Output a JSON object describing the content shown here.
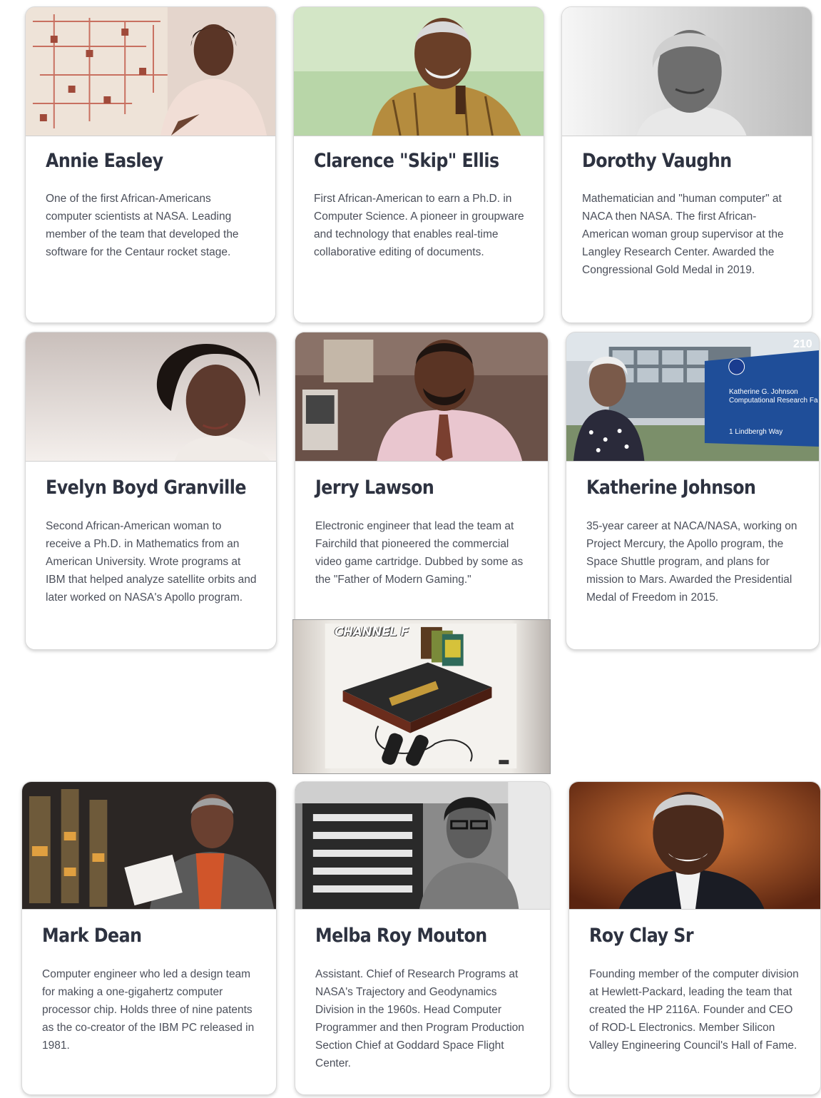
{
  "cards": [
    {
      "name": "Annie Easley",
      "description": "One of the first African-Americans computer scientists at NASA. Leading member of the team that developed the software for the Centaur rocket stage."
    },
    {
      "name": "Clarence \"Skip\" Ellis",
      "description": "First African-American to earn a Ph.D. in Computer Science. A pioneer in groupware and technology that enables real-time collaborative editing of documents."
    },
    {
      "name": "Dorothy Vaughn",
      "description": "Mathematician and \"human computer\" at NACA then NASA. The first African-American woman group supervisor at the Langley Research Center. Awarded the Congressional Gold Medal in 2019."
    },
    {
      "name": "Evelyn Boyd Granville",
      "description": "Second African-American woman to receive a Ph.D. in Mathematics from an American University. Wrote programs at IBM that helped analyze satellite orbits and later worked on NASA's Apollo program."
    },
    {
      "name": "Jerry Lawson",
      "description": "Electronic engineer that lead the team at Fairchild that pioneered the commercial video game cartridge. Dubbed by some as the \"Father of Modern Gaming.\""
    },
    {
      "name": "Katherine Johnson",
      "description": "35-year career at NACA/NASA, working on Project Mercury, the Apollo program, the Space Shuttle program, and plans for mission to Mars. Awarded the Presidential Medal of Freedom in 2015."
    },
    {
      "name": "Mark Dean",
      "description": "Computer engineer who led a design team for making a one-gigahertz computer processor chip. Holds three of nine patents as the co-creator of the IBM PC released in 1981."
    },
    {
      "name": "Melba Roy Mouton",
      "description": "Assistant. Chief of Research Programs at NASA's Trajectory and Geodynamics Division in the 1960s. Head Computer Programmer and then Program Production Section Chief at Goddard Space Flight Center."
    },
    {
      "name": "Roy Clay Sr",
      "description": "Founding member of the computer division at Hewlett-Packard, leading the team that created the HP 2116A. Founder and CEO of ROD-L Electronics. Member Silicon Valley Engineering Council's Hall of Fame."
    }
  ],
  "channel_f": {
    "logo_text": "CHANNEL F"
  },
  "photo_signs": {
    "building_number": "210",
    "sign_line1": "Katherine G. Johnson",
    "sign_line2": "Computational Research Fac",
    "sign_line3": "1 Lindbergh Way"
  }
}
